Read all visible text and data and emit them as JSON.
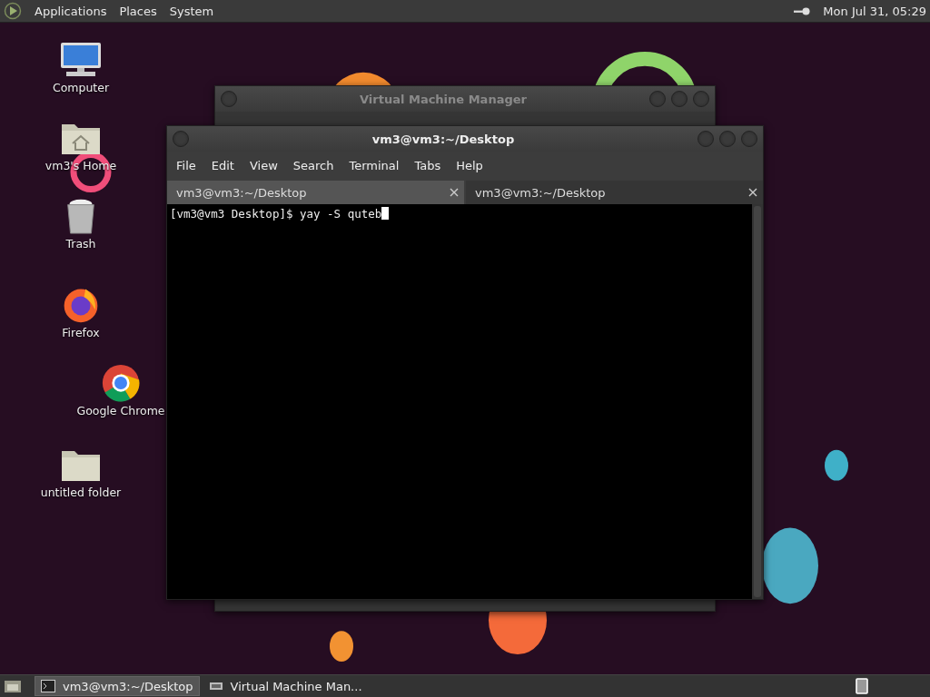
{
  "top_panel": {
    "menus": [
      "Applications",
      "Places",
      "System"
    ],
    "clock": "Mon Jul 31, 05:29"
  },
  "desktop_icons": [
    {
      "kind": "computer",
      "label": "Computer"
    },
    {
      "kind": "home",
      "label": "vm3's Home"
    },
    {
      "kind": "trash",
      "label": "Trash"
    },
    {
      "kind": "firefox",
      "label": "Firefox"
    },
    {
      "kind": "chrome",
      "label": "Google Chrome"
    },
    {
      "kind": "folder",
      "label": "untitled folder"
    }
  ],
  "back_window": {
    "title": "Virtual Machine Manager"
  },
  "terminal": {
    "title": "vm3@vm3:~/Desktop",
    "menu": [
      "File",
      "Edit",
      "View",
      "Search",
      "Terminal",
      "Tabs",
      "Help"
    ],
    "tabs": [
      {
        "label": "vm3@vm3:~/Desktop",
        "selected": true
      },
      {
        "label": "vm3@vm3:~/Desktop",
        "selected": false
      }
    ],
    "prompt": "[vm3@vm3 Desktop]$ yay -S quteb"
  },
  "taskbar": {
    "items": [
      {
        "kind": "terminal",
        "label": "vm3@vm3:~/Desktop",
        "selected": true
      },
      {
        "kind": "vmm",
        "label": "Virtual Machine Man...",
        "selected": false
      }
    ]
  }
}
